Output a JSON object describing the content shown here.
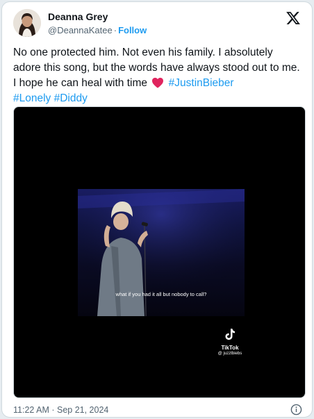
{
  "author": {
    "display_name": "Deanna Grey",
    "handle": "@DeannaKatee",
    "separator": "·",
    "follow_label": "Follow",
    "avatar_icon": "profile-photo",
    "brand_icon": "x-logo-icon"
  },
  "tweet": {
    "text_main": "No one protected him. Not even his family. I absolutely adore this song, but the words have always stood out to me. I hope he can heal with time",
    "emoji": "red-heart",
    "hashtags": [
      "#JustinBieber",
      "#Lonely",
      "#Diddy"
    ]
  },
  "media": {
    "caption": "what if you had it all  but nobody to call?",
    "watermark_label": "TikTok",
    "watermark_user": "@ juzztbiebs"
  },
  "footer": {
    "timestamp": "11:22 AM · Sep 21, 2024",
    "info_icon": "info-icon"
  },
  "colors": {
    "accent": "#1d9bf0",
    "text": "#0f1419",
    "muted": "#536471",
    "heart": "#e0245e"
  }
}
